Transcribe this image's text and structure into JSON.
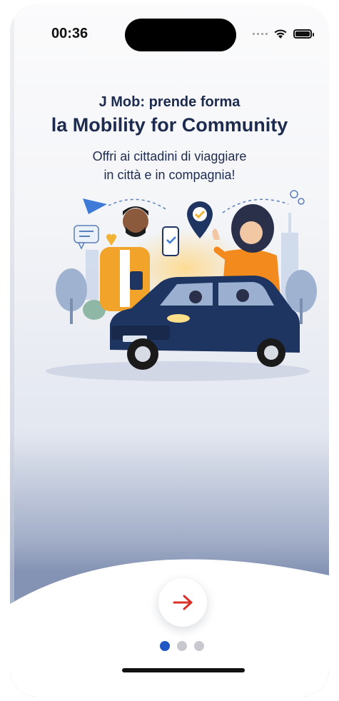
{
  "status_bar": {
    "time": "00:36",
    "icons": [
      "cellular-dots-icon",
      "wifi-icon",
      "battery-icon"
    ]
  },
  "onboarding": {
    "eyebrow": "J Mob: prende forma",
    "headline": "la Mobility for Community",
    "subtitle_line1": "Offri ai cittadini di viaggiare",
    "subtitle_line2": "in città e in compagnia!"
  },
  "illustration": {
    "name": "carpool-community-illustration"
  },
  "controls": {
    "next_icon": "arrow-right-icon",
    "pager": {
      "total_pages": 3,
      "active_page": 1
    }
  },
  "colors": {
    "text_primary": "#1d2b4f",
    "accent_red": "#d9322b",
    "pager_active": "#1f57c3",
    "pager_inactive": "#c7c9ce",
    "car_body": "#1f3561"
  }
}
